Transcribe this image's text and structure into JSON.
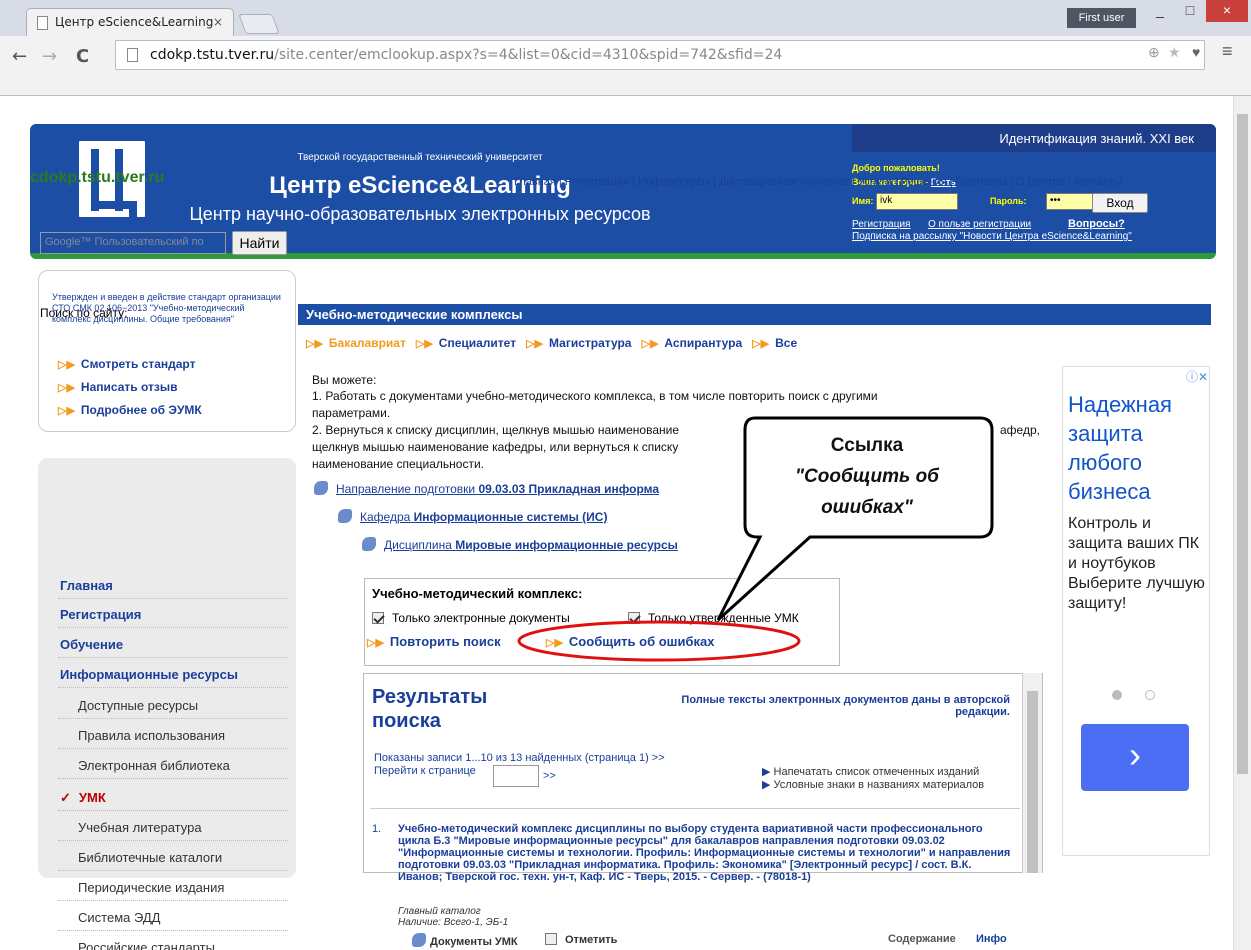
{
  "browser": {
    "tab_title": "Центр eScience&Learning",
    "tab_close": "×",
    "user_label": "First user",
    "btn_min": "_",
    "btn_max": "□",
    "btn_close": "×",
    "back": "←",
    "forward": "→",
    "reload": "C",
    "url_host": "cdokp.tstu.tver.ru",
    "url_path": "/site.center/emclookup.aspx?s=4&list=0&cid=4310&spid=742&sfid=24",
    "zoom": "⊕",
    "star": "★",
    "ext": "♥",
    "menu": "≡"
  },
  "header": {
    "university": "Тверской государственный технический университет",
    "title": "Центр eScience&Learning",
    "subtitle": "Центр научно-образовательных электронных ресурсов",
    "panel_title": "Идентификация знаний. XXI век",
    "welcome": "Добро пожаловать!",
    "category_label": "Ваша категория - ",
    "category_value": "Гость",
    "name_label": "Имя:",
    "name_value": "ivk",
    "pass_label": "Пароль:",
    "pass_value": "•••",
    "login_button": "Вход",
    "register_link": "Регистрация",
    "benefit_link": "О пользе регистрации",
    "questions_link": "Вопросы?",
    "newsletter_link": "Подписка на рассылку \"Новости Центра eScience&Learning\""
  },
  "site_name": "cdokp.tstu.tver.ru",
  "topnav": "Главная | Регистрация | Инфоресурсы | Дистанционное обучение | Услуги | Решения | Партнеры | О Центре | Контакты",
  "left": {
    "search_label": "Поиск по сайту:",
    "search_placeholder": "Google™ Пользовательский по",
    "search_button": "Найти",
    "std_text": "Утвержден и введен в действие стандарт организации СТО СМК 02.106−2013 \"Учебно-методический комплекс дисциплины. Общие требования\"",
    "std_links": [
      "Смотреть стандарт",
      "Написать отзыв",
      "Подробнее об ЭУМК"
    ],
    "menu_main": [
      "Главная",
      "Регистрация",
      "Обучение",
      "Информационные ресурсы"
    ],
    "menu_sub": [
      "Доступные ресурсы",
      "Правила использования",
      "Электронная библиотека"
    ],
    "menu_active": "УМК",
    "menu_check": "✓",
    "menu_sub2": [
      "Учебная литература",
      "Библиотечные каталоги",
      "Периодические издания",
      "Система ЭДД",
      "Российские стандарты"
    ]
  },
  "content": {
    "title": "Учебно-методические комплексы",
    "categories": [
      "Бакалавриат",
      "Специалитет",
      "Магистратура",
      "Аспирантура",
      "Все"
    ],
    "intro": "Вы можете:",
    "p1_line1": "1. Работать с документами учебно-методического комплекса, в том числе повторить поиск с другими",
    "p1_line2": "параметрами.",
    "p2_line1": "2. Вернуться к списку дисциплин, щелкнув мышью наименование",
    "p2_line1b": "афедр,",
    "p2_line2": "щелкнув мышью наименование кафедры, или вернуться к списку",
    "p2_line3": "наименование специальности.",
    "crumb1_label": "Направление подготовки",
    "crumb1_value": "09.03.03 Прикладная информа",
    "crumb2_label": "Кафедра",
    "crumb2_value": "Информационные системы (ИС)",
    "crumb3_label": "Дисциплина",
    "crumb3_value": "Мировые информационные ресурсы",
    "umk_heading": "Учебно-методический комплекс:",
    "opt1": "Только электронные документы",
    "opt2": "Только утвержденные УМК",
    "repeat_search": "Повторить поиск",
    "report_errors": "Сообщить об ошибках",
    "results_title": "Результаты поиска",
    "results_note": "Полные тексты электронных документов даны в авторской редакции.",
    "shown": "Показаны записи 1...10 из 13 найденных (страница 1) >>",
    "goto_page": "Перейти к странице",
    "goto_btn": ">>",
    "print_list": "Напечатать список отмеченных изданий",
    "legend": "Условные знаки в названиях материалов",
    "doc_num": "1.",
    "doc_text": "Учебно-методический комплекс дисциплины по выбору студента вариативной части профессионального цикла Б.3 \"Мировые информационные ресурсы\" для бакалавров направления подготовки 09.03.02 \"Информационные системы и технологии. Профиль: Информационные системы и технологии\" и направления подготовки 09.03.03 \"Прикладная информатика. Профиль: Экономика\" [Электронный ресурс] / сост. В.К. Иванов; Тверской гос. техн. ун-т, Каф. ИС - Тверь, 2015. - Сервер. - (78018-1)",
    "doc_catalog": "Главный каталог",
    "doc_avail": "Наличие: Всего-1, ЭБ-1",
    "doc_umk": "Документы УМК",
    "doc_mark": "Отметить",
    "doc_contents": "Содержание",
    "doc_info": "Инфо"
  },
  "ad": {
    "headline": "Надежная защита любого бизнеса",
    "body": "Контроль и защита ваших ПК и ноутбуков Выберите лучшую защиту!",
    "arrow": "›",
    "badge": "ⓘ✕"
  },
  "callout": {
    "line1": "Ссылка",
    "line2": "\"Сообщить об",
    "line3": "ошибках\""
  }
}
